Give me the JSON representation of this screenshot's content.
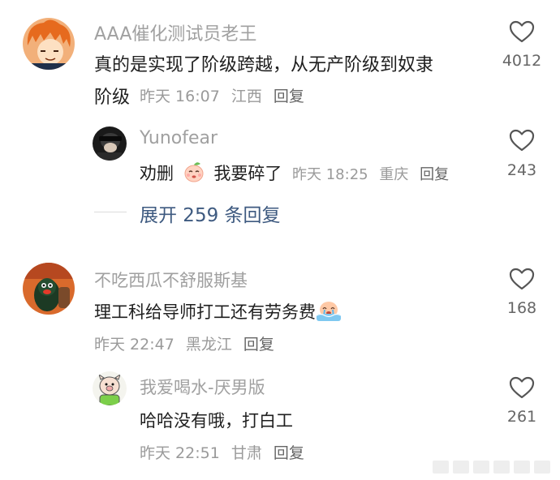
{
  "comments": [
    {
      "username": "AAA催化测试员老王",
      "text_line1": "真的是实现了阶级跨越，从无产阶级到奴隶",
      "text_line2": "阶级",
      "time": "昨天 16:07",
      "location": "江西",
      "reply_label": "回复",
      "likes": "4012",
      "avatar": "anime-orange-hair-avatar",
      "replies": [
        {
          "username": "Yunofear",
          "text_before": "劝删",
          "emoji": "crying-peach-emoji",
          "text_after": "我要碎了",
          "time": "昨天 18:25",
          "location": "重庆",
          "reply_label": "回复",
          "likes": "243",
          "avatar": "dark-cap-avatar"
        }
      ],
      "expand_label": "展开 259 条回复"
    },
    {
      "username": "不吃西瓜不舒服斯基",
      "text": "理工科给导师打工还有劳务费",
      "emoji": "crying-in-water-emoji",
      "time": "昨天 22:47",
      "location": "黑龙江",
      "reply_label": "回复",
      "likes": "168",
      "avatar": "penguin-plush-avatar",
      "replies": [
        {
          "username": "我爱喝水-厌男版",
          "text": "哈哈没有哦，打白工",
          "time": "昨天 22:51",
          "location": "甘肃",
          "reply_label": "回复",
          "likes": "261",
          "avatar": "cartoon-pig-avatar"
        }
      ]
    }
  ],
  "colors": {
    "username": "#a0a0a0",
    "text": "#1f1f1f",
    "meta": "#9a9a9a",
    "expand_link": "#3e5a80"
  }
}
